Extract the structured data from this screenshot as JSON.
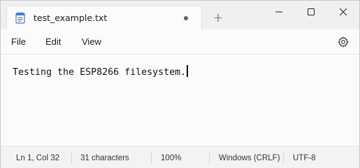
{
  "window": {
    "tab_title": "test_example.txt",
    "file_icon": "notepad-file-icon",
    "new_tab_label": "+"
  },
  "menu": {
    "file": "File",
    "edit": "Edit",
    "view": "View",
    "settings_icon": "gear-icon"
  },
  "editor": {
    "content": "Testing the ESP8266 filesystem."
  },
  "status": {
    "position": "Ln 1, Col 32",
    "characters": "31 characters",
    "zoom": "100%",
    "line_ending": "Windows (CRLF)",
    "encoding": "UTF-8"
  }
}
